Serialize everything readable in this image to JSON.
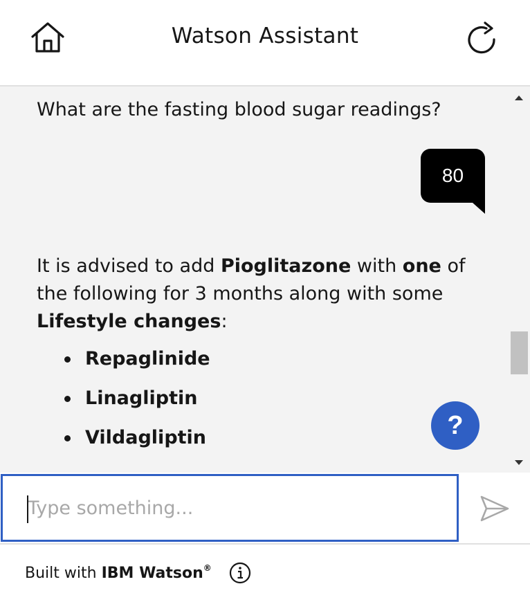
{
  "header": {
    "title": "Watson Assistant",
    "home_icon": "home-icon",
    "restart_icon": "restart-icon"
  },
  "conversation": {
    "bot_question": "What are the fasting blood sugar readings?",
    "user_reply": "80",
    "advice": {
      "part1": "It is advised to add ",
      "drug": "Pioglitazone",
      "part2": " with ",
      "one": "one",
      "part3": " of the following for 3 months along with some ",
      "lifestyle": "Lifestyle changes",
      "part4": ":"
    },
    "medications": [
      "Repaglinide",
      "Linagliptin",
      "Vildagliptin"
    ],
    "help_label": "?"
  },
  "input": {
    "placeholder": "Type something...",
    "value": "",
    "send_icon": "send-icon"
  },
  "footer": {
    "built_with": "Built with ",
    "brand": "IBM Watson",
    "registered": "®",
    "info_icon": "info-icon"
  },
  "colors": {
    "accent": "#2f5fc4",
    "conversation_bg": "#f3f3f3",
    "user_bubble": "#000000"
  }
}
